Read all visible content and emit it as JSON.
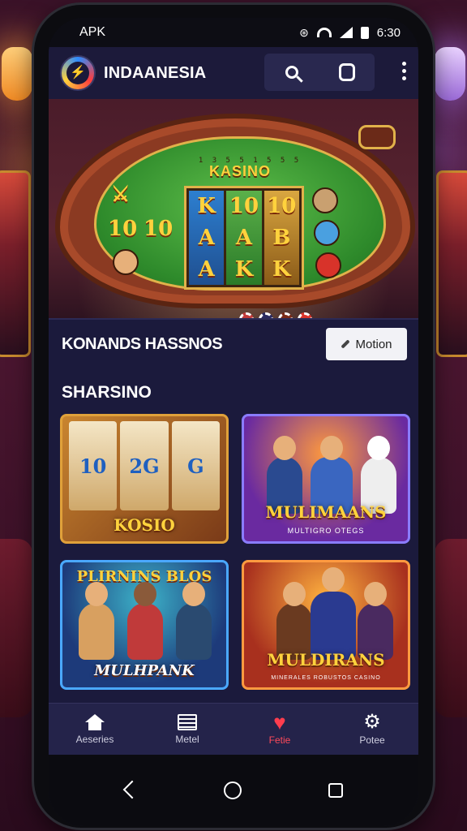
{
  "status": {
    "left_text": "APK",
    "time": "6:30"
  },
  "app": {
    "title": "INDAANESIA",
    "logo_letter": "⚡"
  },
  "hero": {
    "title": "KASINO",
    "ring_text": "1 3 5 5 1 5 5 5",
    "reel_symbols": [
      [
        "K",
        "A",
        "A"
      ],
      [
        "10",
        "A",
        "K"
      ],
      [
        "10",
        "B",
        "K"
      ]
    ],
    "side_symbols_left": [
      "10",
      "10"
    ],
    "colors": {
      "felt": "#2e8a2b",
      "rim": "#e1b24a",
      "wood": "#8b3a22"
    }
  },
  "section": {
    "title": "KONANDS HASSNOS",
    "more_button": "Motion"
  },
  "subsection": {
    "title": "SHARSINO"
  },
  "games": [
    {
      "top": "",
      "title": "KOSIO",
      "subtitle": "",
      "reels": [
        "10",
        "2G",
        "G"
      ]
    },
    {
      "top": "",
      "title": "MULIMAANS",
      "subtitle": "MULTIGRO OTEGS",
      "reels": []
    },
    {
      "top": "PLIRNINS BLOS",
      "title": "MULHPANK",
      "subtitle": "",
      "reels": []
    },
    {
      "top": "",
      "title": "MULDIRANS",
      "subtitle": "MINERALES ROBUSTOS CASINO",
      "reels": []
    }
  ],
  "bottom_nav": [
    {
      "label": "Aeseries",
      "icon": "home-icon",
      "active": false
    },
    {
      "label": "Metel",
      "icon": "list-icon",
      "active": false
    },
    {
      "label": "Fetie",
      "icon": "heart-icon",
      "active": true
    },
    {
      "label": "Potee",
      "icon": "gear-icon",
      "active": false
    }
  ],
  "colors": {
    "appbar": "#1c1a3a",
    "content_bg": "#1b1a3c",
    "accent_red": "#ff3d4e",
    "gold": "#ffd23d"
  }
}
